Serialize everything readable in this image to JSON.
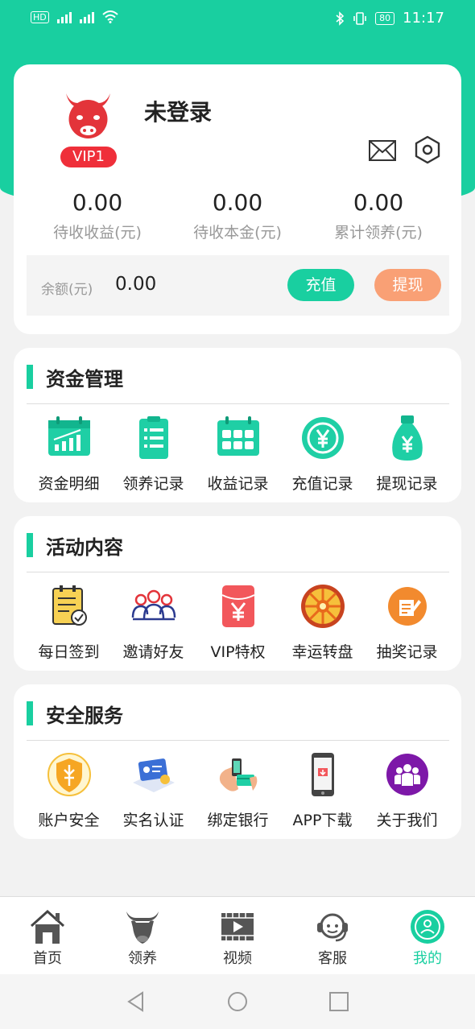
{
  "status": {
    "left_text": "HD",
    "time": "11:17",
    "battery": "80"
  },
  "profile": {
    "username": "未登录",
    "vip": "VIP1",
    "stats": [
      {
        "value": "0.00",
        "label": "待收收益(元)"
      },
      {
        "value": "0.00",
        "label": "待收本金(元)"
      },
      {
        "value": "0.00",
        "label": "累计领养(元)"
      }
    ],
    "balance_label": "余额(元)",
    "balance_value": "0.00",
    "recharge_label": "充值",
    "withdraw_label": "提现"
  },
  "sections": [
    {
      "title": "资金管理",
      "items": [
        {
          "label": "资金明细",
          "icon": "chart-calendar-icon"
        },
        {
          "label": "领养记录",
          "icon": "clipboard-list-icon"
        },
        {
          "label": "收益记录",
          "icon": "calendar-grid-icon"
        },
        {
          "label": "充值记录",
          "icon": "yen-coin-icon"
        },
        {
          "label": "提现记录",
          "icon": "money-bag-icon"
        }
      ]
    },
    {
      "title": "活动内容",
      "items": [
        {
          "label": "每日签到",
          "icon": "checkin-icon"
        },
        {
          "label": "邀请好友",
          "icon": "friends-icon"
        },
        {
          "label": "VIP特权",
          "icon": "vip-red-packet-icon"
        },
        {
          "label": "幸运转盘",
          "icon": "lucky-wheel-icon"
        },
        {
          "label": "抽奖记录",
          "icon": "lottery-record-icon"
        }
      ]
    },
    {
      "title": "安全服务",
      "items": [
        {
          "label": "账户安全",
          "icon": "shield-icon"
        },
        {
          "label": "实名认证",
          "icon": "id-card-icon"
        },
        {
          "label": "绑定银行",
          "icon": "bank-card-icon"
        },
        {
          "label": "APP下载",
          "icon": "phone-download-icon"
        },
        {
          "label": "关于我们",
          "icon": "about-us-icon"
        }
      ]
    }
  ],
  "tabs": [
    {
      "label": "首页",
      "icon": "home-icon"
    },
    {
      "label": "领养",
      "icon": "bull-icon"
    },
    {
      "label": "视频",
      "icon": "video-icon"
    },
    {
      "label": "客服",
      "icon": "headset-icon"
    },
    {
      "label": "我的",
      "icon": "profile-icon",
      "active": true
    }
  ],
  "colors": {
    "accent": "#19cfa0",
    "vip": "#ef2f3a",
    "withdraw": "#f9a075"
  }
}
